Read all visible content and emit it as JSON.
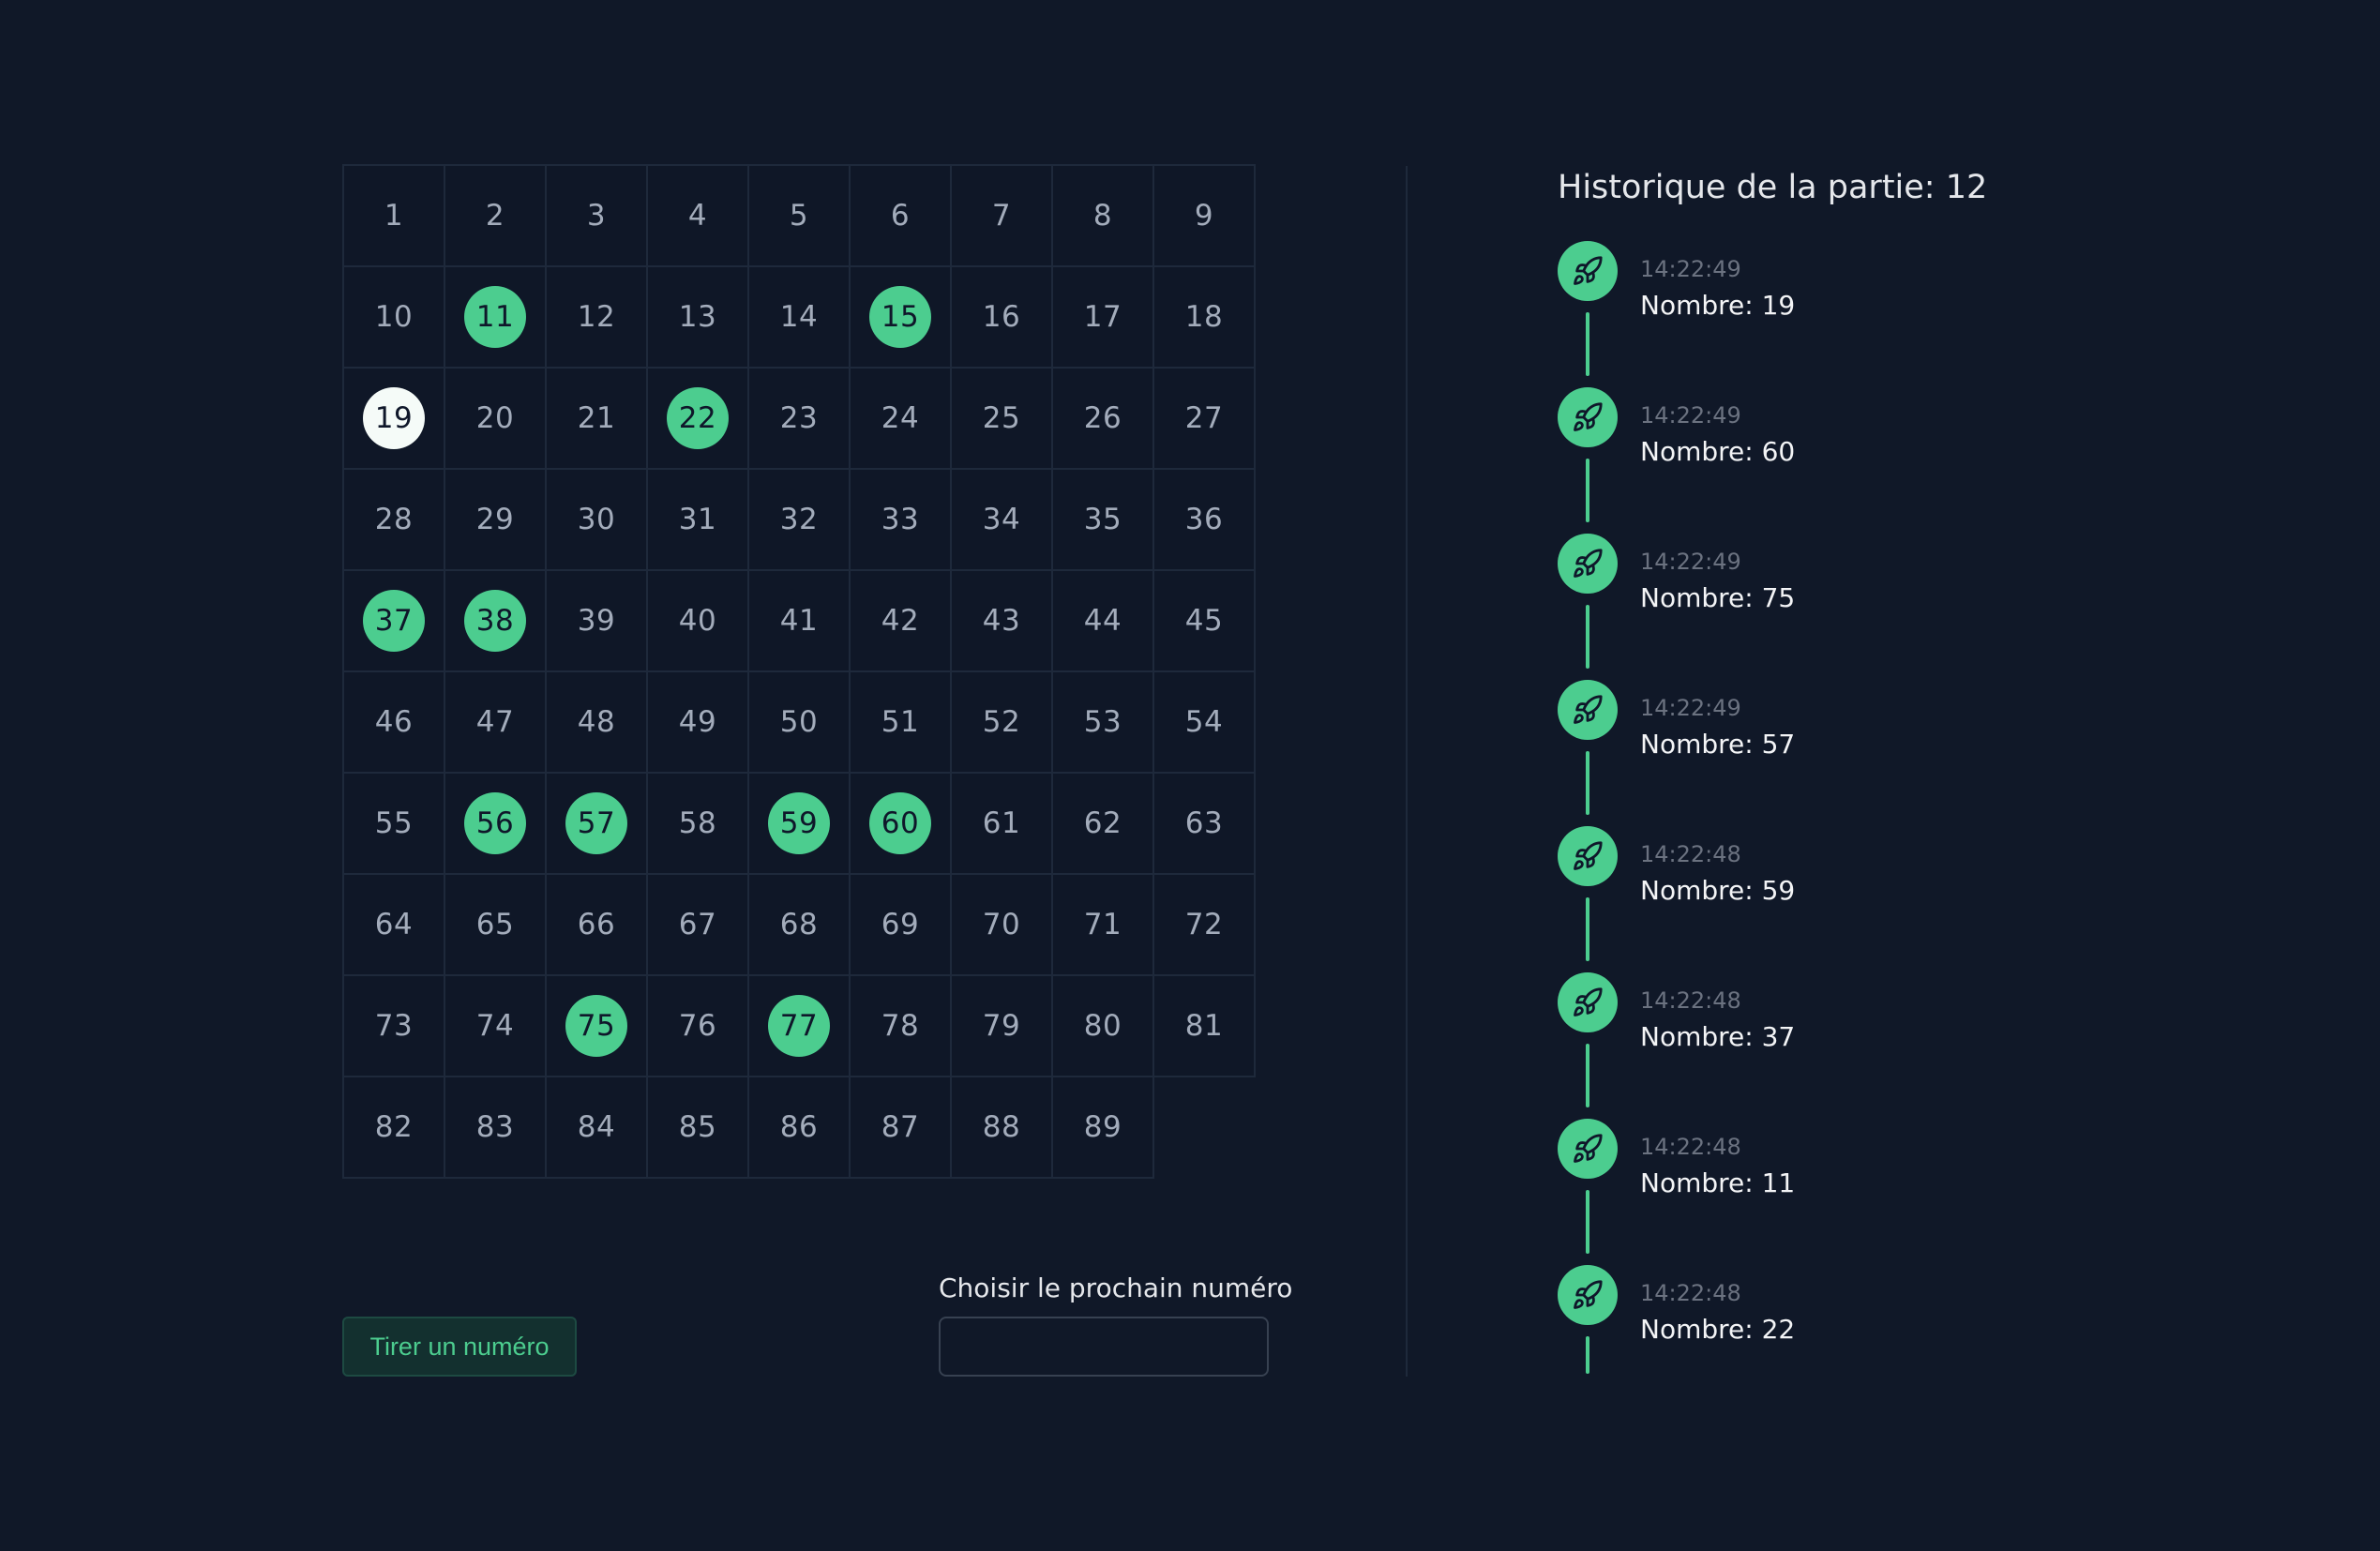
{
  "board": {
    "numbers": [
      1,
      2,
      3,
      4,
      5,
      6,
      7,
      8,
      9,
      10,
      11,
      12,
      13,
      14,
      15,
      16,
      17,
      18,
      19,
      20,
      21,
      22,
      23,
      24,
      25,
      26,
      27,
      28,
      29,
      30,
      31,
      32,
      33,
      34,
      35,
      36,
      37,
      38,
      39,
      40,
      41,
      42,
      43,
      44,
      45,
      46,
      47,
      48,
      49,
      50,
      51,
      52,
      53,
      54,
      55,
      56,
      57,
      58,
      59,
      60,
      61,
      62,
      63,
      64,
      65,
      66,
      67,
      68,
      69,
      70,
      71,
      72,
      73,
      74,
      75,
      76,
      77,
      78,
      79,
      80,
      81,
      82,
      83,
      84,
      85,
      86,
      87,
      88,
      89
    ],
    "columns": 9,
    "drawn": [
      11,
      15,
      22,
      37,
      38,
      56,
      57,
      59,
      60,
      75,
      77
    ],
    "current": 19,
    "drawn_color": "#4ccd8f",
    "current_color": "#f5fbf8"
  },
  "controls": {
    "draw_button_label": "Tirer un numéro",
    "next_label": "Choisir le prochain numéro",
    "next_input_value": ""
  },
  "history": {
    "title": "Historique de la partie: 12",
    "icon": "rocket-icon",
    "accent": "#4ccd8f",
    "entries": [
      {
        "time": "14:22:49",
        "label": "Nombre: 19"
      },
      {
        "time": "14:22:49",
        "label": "Nombre: 60"
      },
      {
        "time": "14:22:49",
        "label": "Nombre: 75"
      },
      {
        "time": "14:22:49",
        "label": "Nombre: 57"
      },
      {
        "time": "14:22:48",
        "label": "Nombre: 59"
      },
      {
        "time": "14:22:48",
        "label": "Nombre: 37"
      },
      {
        "time": "14:22:48",
        "label": "Nombre: 11"
      },
      {
        "time": "14:22:48",
        "label": "Nombre: 22"
      }
    ]
  }
}
